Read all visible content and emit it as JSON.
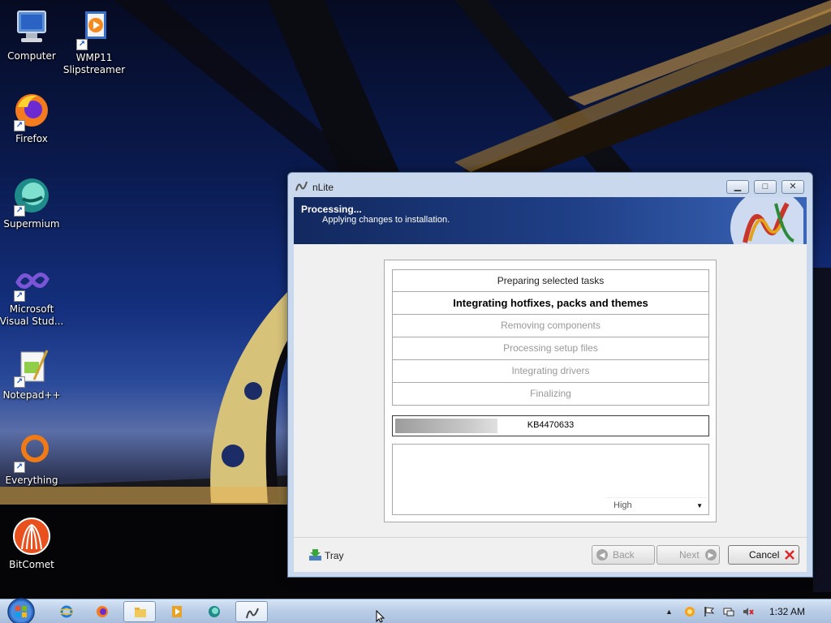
{
  "desktop": {
    "icons": [
      {
        "label": "Computer",
        "icon": "computer-icon"
      },
      {
        "label": "WMP11 Slipstreamer",
        "icon": "wmp-slipstreamer-icon"
      },
      {
        "label": "Firefox",
        "icon": "firefox-icon"
      },
      {
        "label": "Supermium",
        "icon": "supermium-icon"
      },
      {
        "label": "Microsoft Visual Stud...",
        "icon": "visual-studio-icon"
      },
      {
        "label": "Notepad++",
        "icon": "notepad-plus-plus-icon"
      },
      {
        "label": "Everything",
        "icon": "everything-icon"
      },
      {
        "label": "BitComet",
        "icon": "bitcomet-icon"
      }
    ]
  },
  "window": {
    "title": "nLite",
    "controls": {
      "minimize": "minimize-icon",
      "maximize": "maximize-icon",
      "close": "close-icon"
    },
    "header": {
      "title": "Processing...",
      "subtitle": "Applying changes to installation."
    },
    "tasks": [
      {
        "label": "Preparing selected tasks",
        "state": "done"
      },
      {
        "label": "Integrating hotfixes, packs and themes",
        "state": "active"
      },
      {
        "label": "Removing components",
        "state": "pending"
      },
      {
        "label": "Processing setup files",
        "state": "pending"
      },
      {
        "label": "Integrating drivers",
        "state": "pending"
      },
      {
        "label": "Finalizing",
        "state": "pending"
      }
    ],
    "progress": {
      "label": "KB4470633",
      "fraction": 0.33
    },
    "priority": {
      "selected": "High"
    },
    "buttons": {
      "tray": "Tray",
      "back": "Back",
      "next": "Next",
      "cancel": "Cancel"
    }
  },
  "taskbar": {
    "pinned": [
      "internet-explorer-icon",
      "firefox-icon",
      "file-explorer-icon",
      "media-player-icon",
      "supermium-icon",
      "nlite-icon"
    ],
    "clock": "1:32 AM"
  },
  "colors": {
    "header_dark": "#12295f",
    "header_light": "#3b66b8",
    "cancel_x": "#d8282b"
  }
}
